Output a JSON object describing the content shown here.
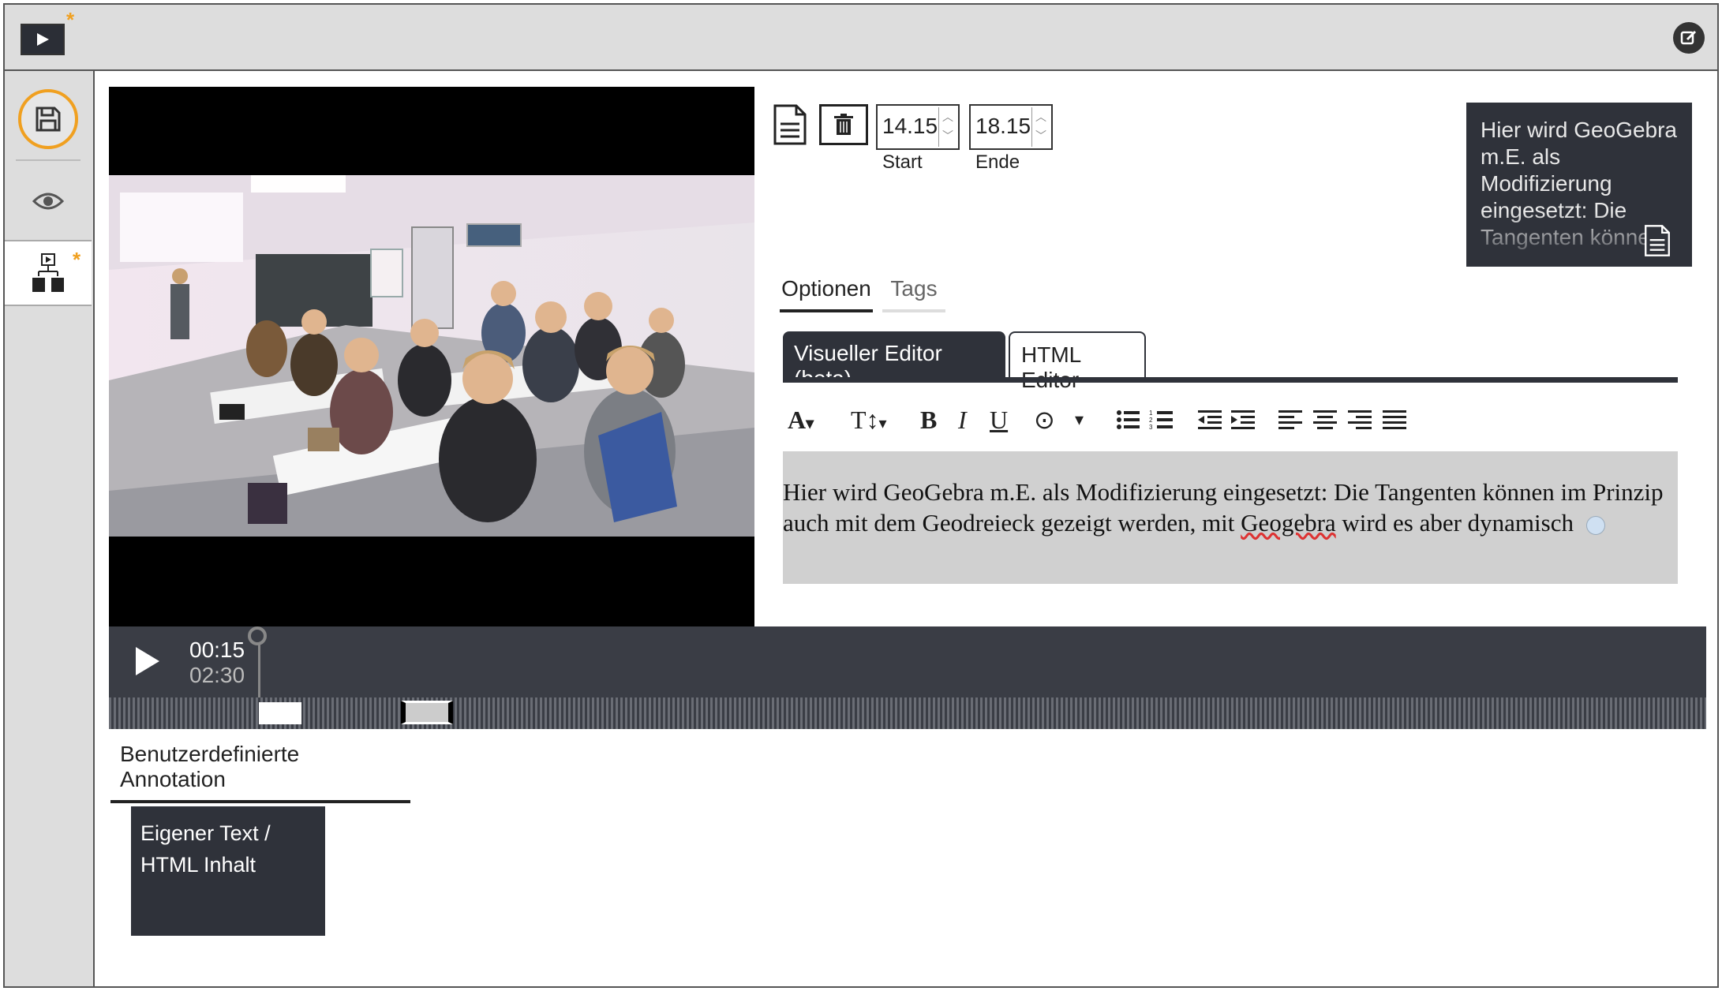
{
  "topbar": {
    "logo_icon": "play-icon",
    "edit_icon": "edit-icon",
    "unsaved_marker": "*"
  },
  "sidebar": {
    "save_icon": "floppy-disk-icon",
    "preview_icon": "eye-icon",
    "structure_icon": "flow-structure-icon",
    "unsaved_marker": "*"
  },
  "segment": {
    "start_value": "14.15",
    "start_label": "Start",
    "end_value": "18.15",
    "end_label": "Ende",
    "note_preview": "Hier wird GeoGebra m.E. als Modifizierung eingesetzt: Die Tangenten können"
  },
  "tabs": [
    {
      "label": "Optionen",
      "active": true
    },
    {
      "label": "Tags",
      "active": false
    }
  ],
  "editor_tabs": [
    {
      "label": "Visueller Editor (beta)",
      "active": true
    },
    {
      "label": "HTML Editor",
      "active": false
    }
  ],
  "toolbar": {
    "font": "A",
    "text_size": "T↕",
    "bold": "B",
    "italic": "I",
    "underline": "U",
    "color": "⊙",
    "dropdown": "▾"
  },
  "editor_content": {
    "text": "Hier wird GeoGebra m.E. als Modifizierung eingesetzt: Die Tangenten können im Prinzip auch mit dem Geodreieck gezeigt werden, mit ",
    "misspelled": "Geogebra",
    "text_after": " wird es aber dynamisch"
  },
  "player": {
    "current_time": "00:15",
    "total_time": "02:30",
    "progress": 0.1
  },
  "annotations": {
    "section_title": "Benutzerdefinierte Annotation",
    "card_label_line1": "Eigener Text /",
    "card_label_line2": "HTML Inhalt"
  },
  "colors": {
    "accent": "#f0a020",
    "dark": "#2f323a",
    "controls": "#3a3d45"
  }
}
